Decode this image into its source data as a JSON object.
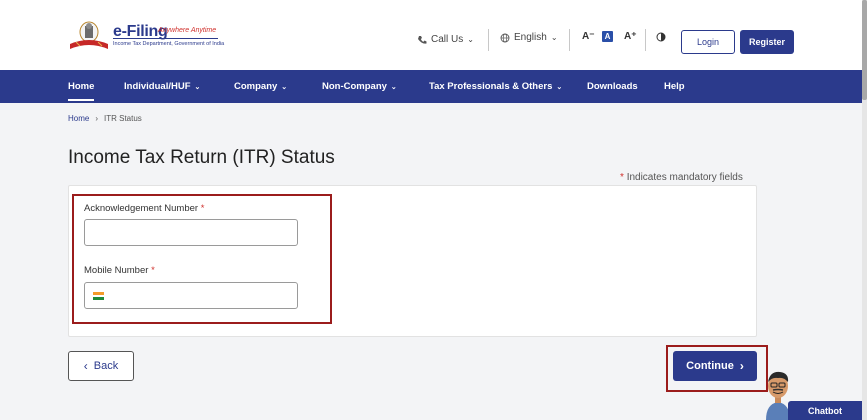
{
  "header": {
    "logo_title": "e-Filing",
    "logo_tagline": "Anywhere Anytime",
    "logo_subtitle": "Income Tax Department, Government of India",
    "call_us": "Call Us",
    "language": "English",
    "font_small": "A⁻",
    "font_normal": "A",
    "font_large": "A⁺",
    "login": "Login",
    "register": "Register"
  },
  "nav": {
    "items": [
      {
        "label": "Home",
        "chevron": false
      },
      {
        "label": "Individual/HUF",
        "chevron": true
      },
      {
        "label": "Company",
        "chevron": true
      },
      {
        "label": "Non-Company",
        "chevron": true
      },
      {
        "label": "Tax Professionals & Others",
        "chevron": true
      },
      {
        "label": "Downloads",
        "chevron": false
      },
      {
        "label": "Help",
        "chevron": false
      }
    ]
  },
  "breadcrumb": {
    "home": "Home",
    "separator": "›",
    "current": "ITR Status"
  },
  "page": {
    "title": "Income Tax Return (ITR) Status",
    "mandatory_star": "*",
    "mandatory_note": "Indicates mandatory fields"
  },
  "form": {
    "ack_label": "Acknowledgement Number",
    "ack_value": "",
    "mobile_label": "Mobile Number",
    "mobile_value": "",
    "required_star": "*"
  },
  "actions": {
    "back": "Back",
    "continue": "Continue"
  },
  "chatbot": {
    "label": "Chatbot"
  },
  "colors": {
    "brand_navy": "#2b3a8c",
    "highlight_red": "#9b1c1c",
    "required_red": "#d0312d"
  }
}
